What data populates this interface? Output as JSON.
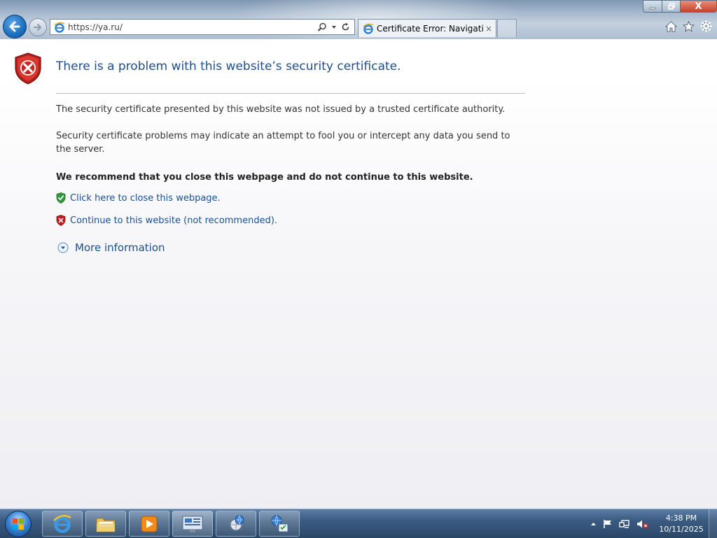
{
  "browser": {
    "address_url": "https://ya.ru/",
    "tab_title": "Certificate Error: Navigation...",
    "tab_close": "×",
    "window_controls": {
      "close_glyph": "X"
    },
    "icons": [
      "back-arrow-icon",
      "forward-arrow-icon",
      "ie-icon",
      "search-icon",
      "dropdown-arrow-icon",
      "refresh-icon",
      "home-icon",
      "favorites-star-icon",
      "tools-gear-icon"
    ]
  },
  "page": {
    "heading": "There is a problem with this website’s security certificate.",
    "paragraph1": "The security certificate presented by this website was not issued by a trusted certificate authority.",
    "paragraph2": "Security certificate problems may indicate an attempt to fool you or intercept any data you send to the server.",
    "recommendation": "We recommend that you close this webpage and do not continue to this website.",
    "close_link": "Click here to close this webpage.",
    "continue_link": "Continue to this website (not recommended).",
    "more_info": "More information"
  },
  "taskbar": {
    "pinned": [
      "internet-explorer",
      "windows-explorer",
      "media-player",
      "server-manager",
      "network-globe",
      "network-settings"
    ],
    "clock_time": "4:38 PM",
    "clock_date": "10/11/2025"
  },
  "colors": {
    "heading": "#1f4e8c",
    "link": "#1c4f8e",
    "text": "#333333",
    "shield_red": "#c21f1f",
    "shield_green": "#2e9a3a"
  }
}
